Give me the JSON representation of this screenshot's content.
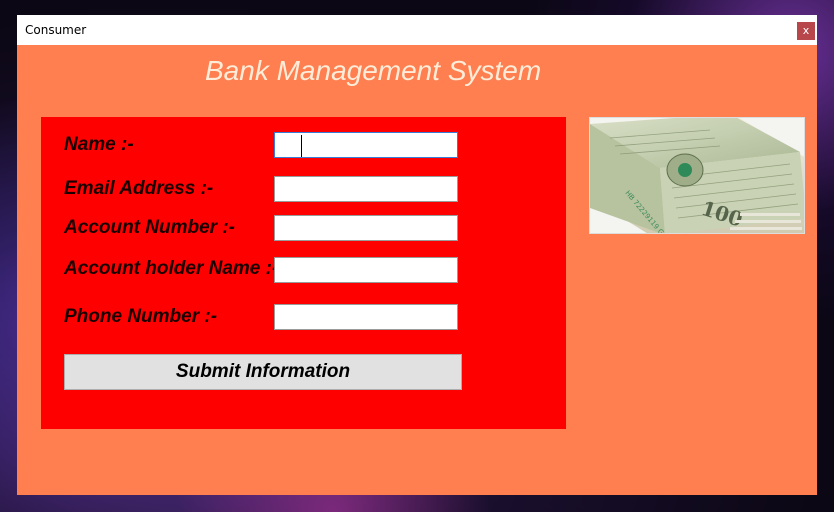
{
  "window": {
    "title": "Consumer",
    "close_label": "x"
  },
  "app": {
    "heading": "Bank Management System"
  },
  "form": {
    "fields": [
      {
        "label": "Name :-",
        "value": ""
      },
      {
        "label": "Email Address :-",
        "value": ""
      },
      {
        "label": "Account Number :-",
        "value": ""
      },
      {
        "label": "Account holder Name :-",
        "value": ""
      },
      {
        "label": "Phone Number :-",
        "value": ""
      }
    ],
    "submit_label": "Submit Information"
  },
  "image": {
    "icon": "money-stack-image"
  },
  "colors": {
    "window_bg": "#ff7f50",
    "panel_bg": "#ff0000",
    "heading": "#fdecd8",
    "close_button": "#b8474b"
  }
}
